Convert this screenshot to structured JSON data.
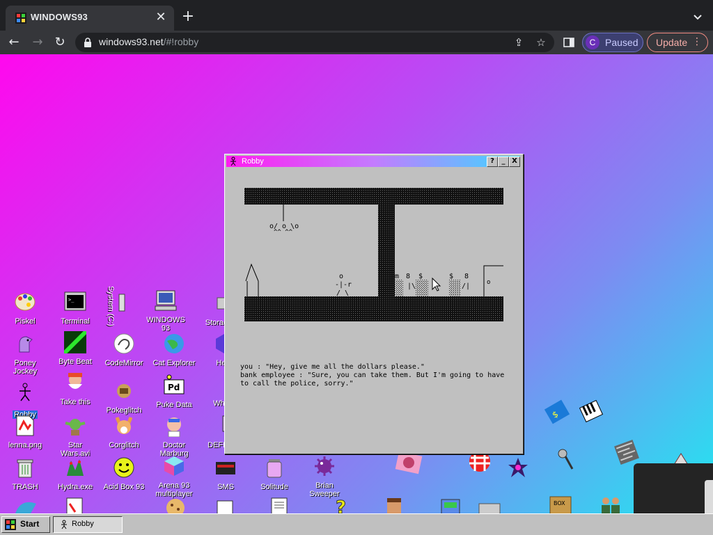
{
  "browser": {
    "tab_title": "WINDOWS93",
    "url_host": "windows93.net",
    "url_rest": "/#!robby",
    "profile_initial": "C",
    "profile_status": "Paused",
    "update_label": "Update"
  },
  "desktop_icons": [
    {
      "label": "Piskel"
    },
    {
      "label": "Terminal"
    },
    {
      "label": "System (C:)"
    },
    {
      "label": "WINDOWS 93"
    },
    {
      "label": "Storage"
    },
    {
      "label": "Poney Jockey"
    },
    {
      "label": "Byte Beat"
    },
    {
      "label": "CodeMirror"
    },
    {
      "label": "Cat Explorer"
    },
    {
      "label": "He..."
    },
    {
      "label": "Robby"
    },
    {
      "label": "Take this"
    },
    {
      "label": "Pokeglitch"
    },
    {
      "label": "Puke Data"
    },
    {
      "label": "Wha..."
    },
    {
      "label": "lenna.png"
    },
    {
      "label": "Star Wars.avi"
    },
    {
      "label": "Corglitch"
    },
    {
      "label": "Doctor Marburg"
    },
    {
      "label": "DEFRG..."
    },
    {
      "label": "TRASH"
    },
    {
      "label": "Hydra.exe"
    },
    {
      "label": "Acid Box 93"
    },
    {
      "label": "Arena 93 multiplayer"
    },
    {
      "label": "SMS"
    },
    {
      "label": "Solitude"
    },
    {
      "label": "Brian Sweeper"
    }
  ],
  "window": {
    "title": "Robby",
    "help": "?",
    "minimize": "_",
    "close": "X",
    "dialog": "you : \"Hey, give me all the dollars please.\"\nbank employee : \"Sure, you can take them. But I'm going to have\nto call the police, sorry.\""
  },
  "taskbar": {
    "start_label": "Start",
    "task_label": "Robby"
  }
}
